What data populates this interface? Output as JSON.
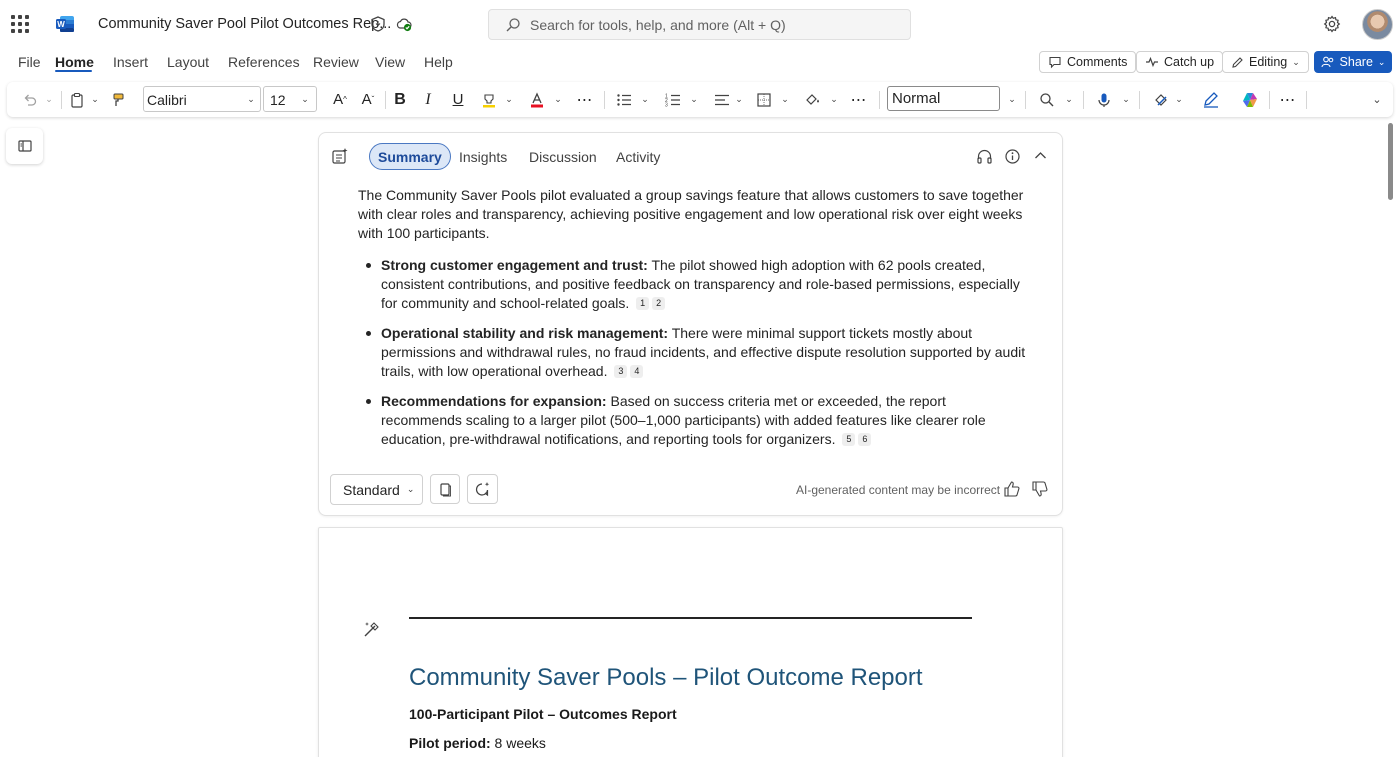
{
  "titlebar": {
    "doc_title": "Community Saver Pool Pilot Outcomes Rep...",
    "search_placeholder": "Search for tools, help, and more (Alt + Q)"
  },
  "menu": {
    "items": [
      "File",
      "Home",
      "Insert",
      "Layout",
      "References",
      "Review",
      "View",
      "Help"
    ],
    "active": "Home",
    "comments": "Comments",
    "catch_up": "Catch up",
    "editing": "Editing",
    "share": "Share"
  },
  "ribbon": {
    "font": "Calibri",
    "size": "12",
    "style": "Normal"
  },
  "summary": {
    "tabs": [
      "Summary",
      "Insights",
      "Discussion",
      "Activity"
    ],
    "active_tab": "Summary",
    "intro": "The Community Saver Pools pilot evaluated a group savings feature that allows customers to save together with clear roles and transparency, achieving positive engagement and low operational risk over eight weeks with 100 participants.",
    "bullets": [
      {
        "title": "Strong customer engagement and trust:",
        "text": " The pilot showed high adoption with 62 pools created, consistent contributions, and positive feedback on transparency and role-based permissions, especially for community and school-related goals.",
        "cites": [
          "1",
          "2"
        ]
      },
      {
        "title": "Operational stability and risk management:",
        "text": " There were minimal support tickets mostly about permissions and withdrawal rules, no fraud incidents, and effective dispute resolution supported by audit trails, with low operational overhead.",
        "cites": [
          "3",
          "4"
        ]
      },
      {
        "title": "Recommendations for expansion:",
        "text": " Based on success criteria met or exceeded, the report recommends scaling to a larger pilot (500–1,000 participants) with added features like clearer role education, pre-withdrawal notifications, and reporting tools for organizers.",
        "cites": [
          "5",
          "6"
        ]
      }
    ],
    "mode": "Standard",
    "ai_note": "AI-generated content may be incorrect"
  },
  "document": {
    "heading": "Community Saver Pools – Pilot Outcome Report",
    "subtitle": "100-Participant Pilot – Outcomes Report",
    "period_label": "Pilot period:",
    "period_value": " 8 weeks"
  },
  "colors": {
    "accent": "#185abd",
    "heading": "#1f5479",
    "active_tab_bg": "#dce7f7"
  }
}
